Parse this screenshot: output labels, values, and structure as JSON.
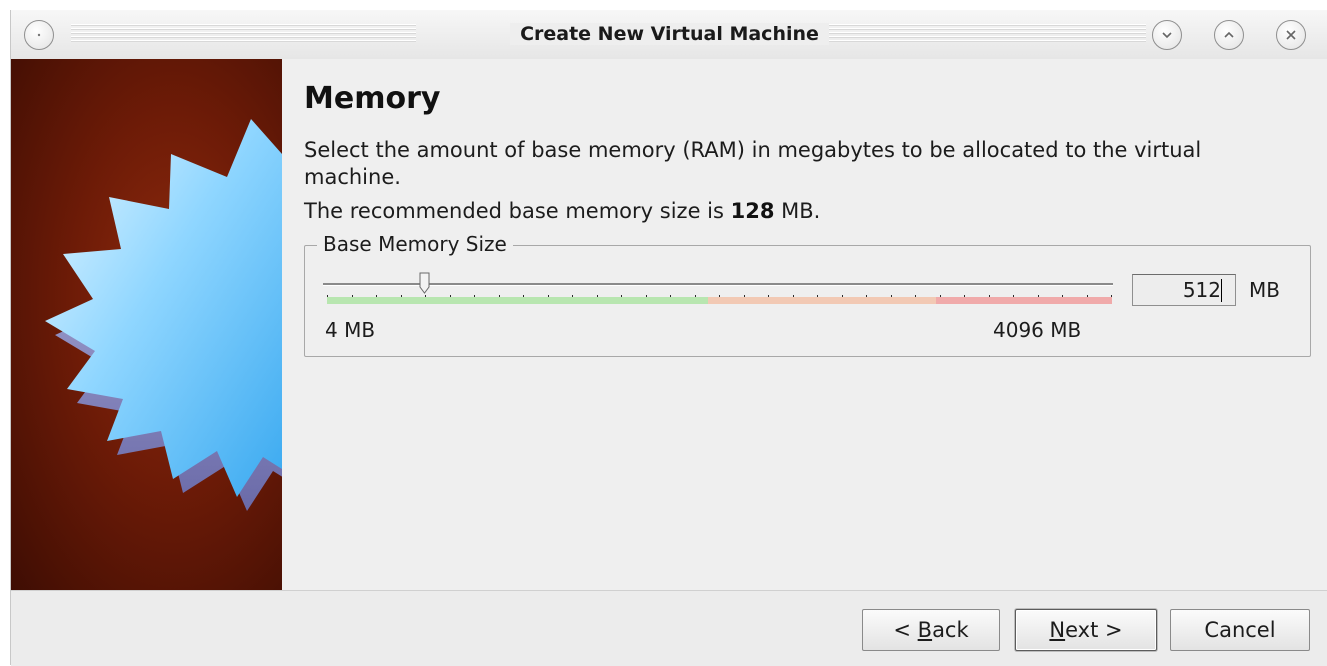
{
  "window": {
    "title": "Create New Virtual Machine"
  },
  "page": {
    "heading": "Memory",
    "description": "Select the amount of base memory (RAM) in megabytes to be allocated to the virtual machine.",
    "recommend_prefix": "The recommended base memory size is ",
    "recommend_value": "128",
    "recommend_suffix": " MB."
  },
  "memory_group": {
    "title": "Base Memory Size",
    "min_label": "4 MB",
    "max_label": "4096 MB",
    "value": "512",
    "unit": "MB",
    "slider_fraction": 0.124
  },
  "buttons": {
    "back": "< Back",
    "next": "Next >",
    "cancel": "Cancel"
  },
  "colors": {
    "scale_green": "#b8e6b0",
    "scale_orange": "#f2c9b4",
    "scale_red": "#f0aaaa",
    "banner_dark": "#3e0d03",
    "banner_light": "#8e2a0e"
  },
  "icons": {
    "window_menu": "circle-dot-icon",
    "minimize": "chevron-down-icon",
    "maximize": "chevron-up-icon",
    "close": "close-icon",
    "banner": "starburst-icon"
  }
}
